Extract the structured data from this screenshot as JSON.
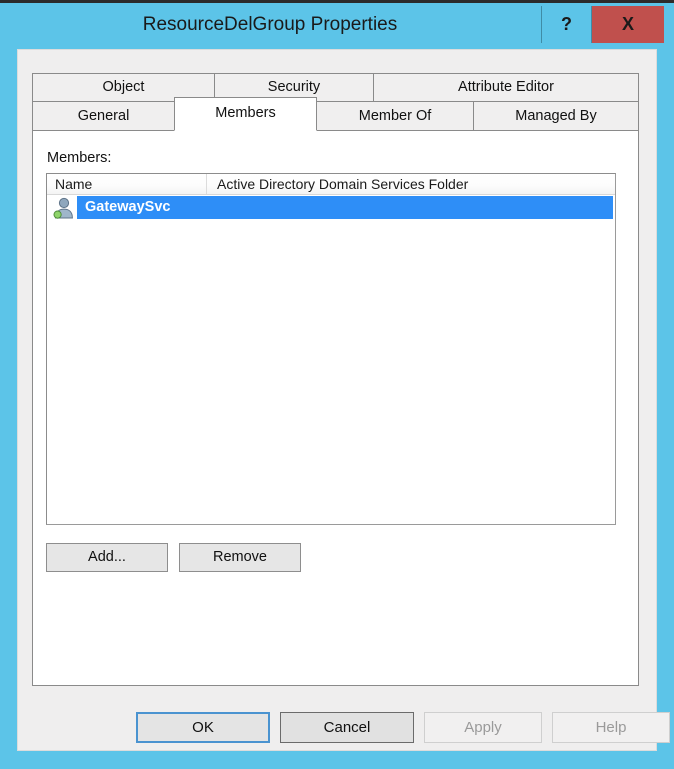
{
  "window": {
    "title": "ResourceDelGroup Properties",
    "titlebar_color": "#5CC4E8",
    "close_button_color": "#C0504D",
    "help_button_label": "?",
    "close_button_label": "X"
  },
  "tabs": {
    "row1": [
      {
        "label": "Object",
        "selected": false
      },
      {
        "label": "Security",
        "selected": false
      },
      {
        "label": "Attribute Editor",
        "selected": false
      }
    ],
    "row2": [
      {
        "label": "General",
        "selected": false
      },
      {
        "label": "Members",
        "selected": true
      },
      {
        "label": "Member Of",
        "selected": false
      },
      {
        "label": "Managed By",
        "selected": false
      }
    ]
  },
  "members_page": {
    "label": "Members:",
    "columns": [
      "Name",
      "Active Directory Domain Services Folder"
    ],
    "rows": [
      {
        "name": "GatewaySvc",
        "folder": "",
        "icon": "user-icon",
        "selected": true
      }
    ],
    "selection_color": "#2e8ef7",
    "add_label": "Add...",
    "remove_label": "Remove"
  },
  "footer": {
    "ok_label": "OK",
    "cancel_label": "Cancel",
    "apply_label": "Apply",
    "help_label": "Help",
    "apply_enabled": false,
    "help_enabled": false
  }
}
